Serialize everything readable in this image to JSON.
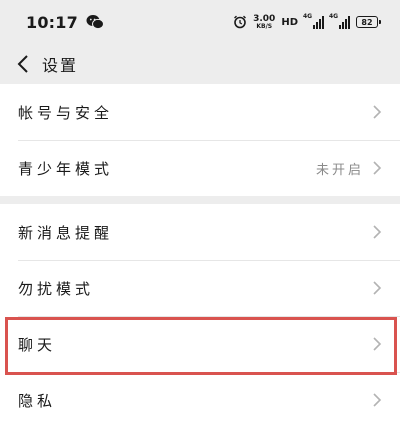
{
  "status": {
    "time": "10:17",
    "speed_value": "3.00",
    "speed_unit": "KB/S",
    "hd_badge": "HD",
    "signal1_label": "4G",
    "signal2_label": "4G",
    "battery": "82"
  },
  "nav": {
    "title": "设置"
  },
  "groups": [
    {
      "items": [
        {
          "label": "帐号与安全"
        },
        {
          "label": "青少年模式",
          "value": "未开启"
        }
      ]
    },
    {
      "items": [
        {
          "label": "新消息提醒"
        },
        {
          "label": "勿扰模式"
        },
        {
          "label": "聊天"
        },
        {
          "label": "隐私"
        }
      ]
    }
  ],
  "icons": {
    "back": "chevron-left-icon",
    "row_arrow": "chevron-right-icon",
    "status_app": "wechat-icon",
    "alarm": "alarm-icon"
  },
  "colors": {
    "background": "#ededed",
    "card": "#ffffff",
    "highlight": "#d9534f",
    "secondary_text": "#8a8a8a"
  }
}
